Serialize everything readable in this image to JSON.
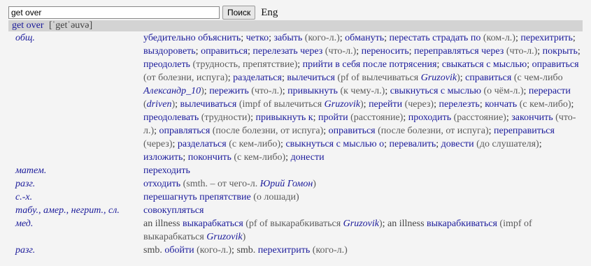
{
  "search": {
    "value": "get over",
    "button_label": "Поиск",
    "lang_label": "Eng"
  },
  "header": {
    "word": "get over",
    "transcription": "[ˈgetˈəuvə]"
  },
  "colors": {
    "term": "#1a1a9a",
    "note": "#5a5a5a",
    "header_bg": "#d3d3d3"
  },
  "entries": [
    {
      "subject": "общ.",
      "items": [
        {
          "t": "убедительно объяснить"
        },
        {
          "t": "четко"
        },
        {
          "t": "забыть",
          "n": "(кого-л.)"
        },
        {
          "t": "обмануть"
        },
        {
          "t": "перестать страдать по",
          "n": "(ком-л.)"
        },
        {
          "t": "перехитрить"
        },
        {
          "t": "выздороветь"
        },
        {
          "t": "оправиться"
        },
        {
          "t": "перелезать через",
          "n": "(что-л.)"
        },
        {
          "t": "переносить"
        },
        {
          "t": "переправляться через",
          "n": "(что-л.)"
        },
        {
          "t": "покрыть"
        },
        {
          "t": "преодолеть",
          "n": "(трудность, препятствие)"
        },
        {
          "t": "прийти в себя после потрясения"
        },
        {
          "t": "свыкаться с мыслью"
        },
        {
          "t": "оправиться",
          "n": "(от болезни, испуга)"
        },
        {
          "t": "разделаться"
        },
        {
          "t": "вылечиться",
          "n": "(pf of вылечиваться",
          "a": "Gruzovik",
          "c": ")"
        },
        {
          "t": "справиться",
          "n": "(с чем-либо",
          "a": "Александр_10",
          "c": ")"
        },
        {
          "t": "пережить",
          "n": "(что-л.)"
        },
        {
          "t": "привыкнуть",
          "n": "(к чему-л.)"
        },
        {
          "t": "свыкнуться с мыслью",
          "n": "(о чём-л.)"
        },
        {
          "t": "перерасти",
          "n": "(",
          "a": "driven",
          "c": ")"
        },
        {
          "t": "вылечиваться",
          "n": "(impf of вылечиться",
          "a": "Gruzovik",
          "c": ")"
        },
        {
          "t": "перейти",
          "n": "(через)"
        },
        {
          "t": "перелезть"
        },
        {
          "t": "кончать",
          "n": "(с кем-либо)"
        },
        {
          "t": "преодолевать",
          "n": "(трудности)"
        },
        {
          "t": "привыкнуть к"
        },
        {
          "t": "пройти",
          "n": "(расстояние)"
        },
        {
          "t": "проходить",
          "n": "(расстояние)"
        },
        {
          "t": "закончить",
          "n": "(что-л.)"
        },
        {
          "t": "оправляться",
          "n": "(после болезни, от испуга)"
        },
        {
          "t": "оправиться",
          "n": "(после болезни, от испуга)"
        },
        {
          "t": "переправиться",
          "n": "(через)"
        },
        {
          "t": "разделаться",
          "n": "(с кем-либо)"
        },
        {
          "t": "свыкнуться с мыслью о"
        },
        {
          "t": "перевалить"
        },
        {
          "t": "довести",
          "n": "(до слушателя)"
        },
        {
          "t": "изложить"
        },
        {
          "t": "покончить",
          "n": "(с кем-либо)"
        },
        {
          "t": "донести"
        }
      ]
    },
    {
      "subject": "матем.",
      "items": [
        {
          "t": "переходить"
        }
      ]
    },
    {
      "subject": "разг.",
      "items": [
        {
          "t": "отходить",
          "n": "(smth. – от чего-л.",
          "a": "Юрий Гомон",
          "c": ")"
        }
      ]
    },
    {
      "subject": "с.-х.",
      "items": [
        {
          "t": "перешагнуть препятствие",
          "n": "(о лошади)"
        }
      ]
    },
    {
      "subject": "табу., амер., негрит., сл.",
      "items": [
        {
          "t": "совокупляться"
        }
      ]
    },
    {
      "subject": "мед.",
      "items": [
        {
          "e": "an illness",
          "t": "выкарабкаться",
          "n": "(pf of выкарабкиваться",
          "a": "Gruzovik",
          "c": ")"
        },
        {
          "e": "an illness",
          "t": "выкарабкиваться",
          "n": "(impf of выкарабкаться",
          "a": "Gruzovik",
          "c": ")"
        }
      ]
    },
    {
      "subject": "разг.",
      "items": [
        {
          "e": "smb.",
          "t": "обойти",
          "n": "(кого-л.)"
        },
        {
          "e": "smb.",
          "t": "перехитрить",
          "n": "(кого-л.)"
        }
      ]
    }
  ]
}
